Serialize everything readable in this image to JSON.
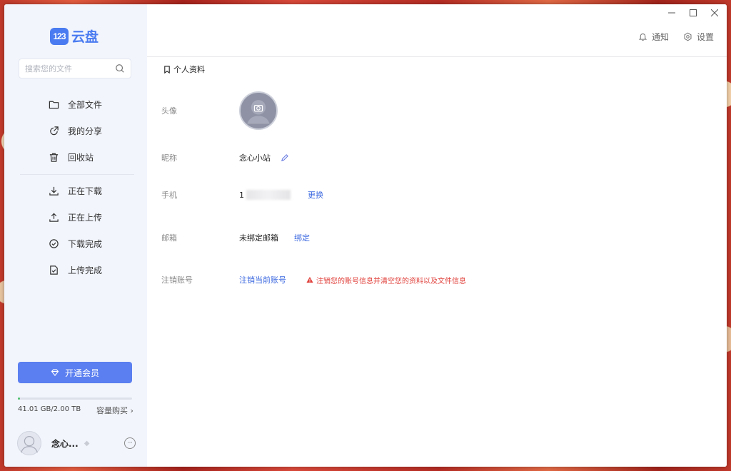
{
  "sidebar": {
    "logo_badge": "123",
    "logo_text": "云盘",
    "search_placeholder": "搜索您的文件",
    "nav_top": [
      {
        "label": "全部文件",
        "icon": "folder-icon"
      },
      {
        "label": "我的分享",
        "icon": "share-icon"
      },
      {
        "label": "回收站",
        "icon": "trash-icon"
      }
    ],
    "nav_transfer": [
      {
        "label": "正在下载",
        "icon": "download-icon"
      },
      {
        "label": "正在上传",
        "icon": "upload-icon"
      },
      {
        "label": "下载完成",
        "icon": "check-circle-icon"
      },
      {
        "label": "上传完成",
        "icon": "check-file-icon"
      }
    ],
    "vip_label": "开通会员",
    "storage": {
      "used_text": "41.01 GB/2.00 TB",
      "used_fraction": 0.02,
      "buy_label": "容量购买"
    },
    "user_name": "念心..."
  },
  "header": {
    "notify_label": "通知",
    "settings_label": "设置"
  },
  "profile": {
    "section_title": "个人资料",
    "avatar_label": "头像",
    "nickname_label": "昵称",
    "nickname_value": "念心小站",
    "phone_label": "手机",
    "phone_value": "1",
    "phone_change": "更换",
    "email_label": "邮箱",
    "email_value": "未绑定邮箱",
    "email_bind": "绑定",
    "cancel_label": "注销账号",
    "cancel_link": "注销当前账号",
    "cancel_warning": "注销您的账号信息并清空您的资料以及文件信息"
  },
  "colors": {
    "accent": "#4a7bf0",
    "vip": "#5b7ff0",
    "warning": "#e0403b",
    "storage_fill": "#4cc06b"
  }
}
